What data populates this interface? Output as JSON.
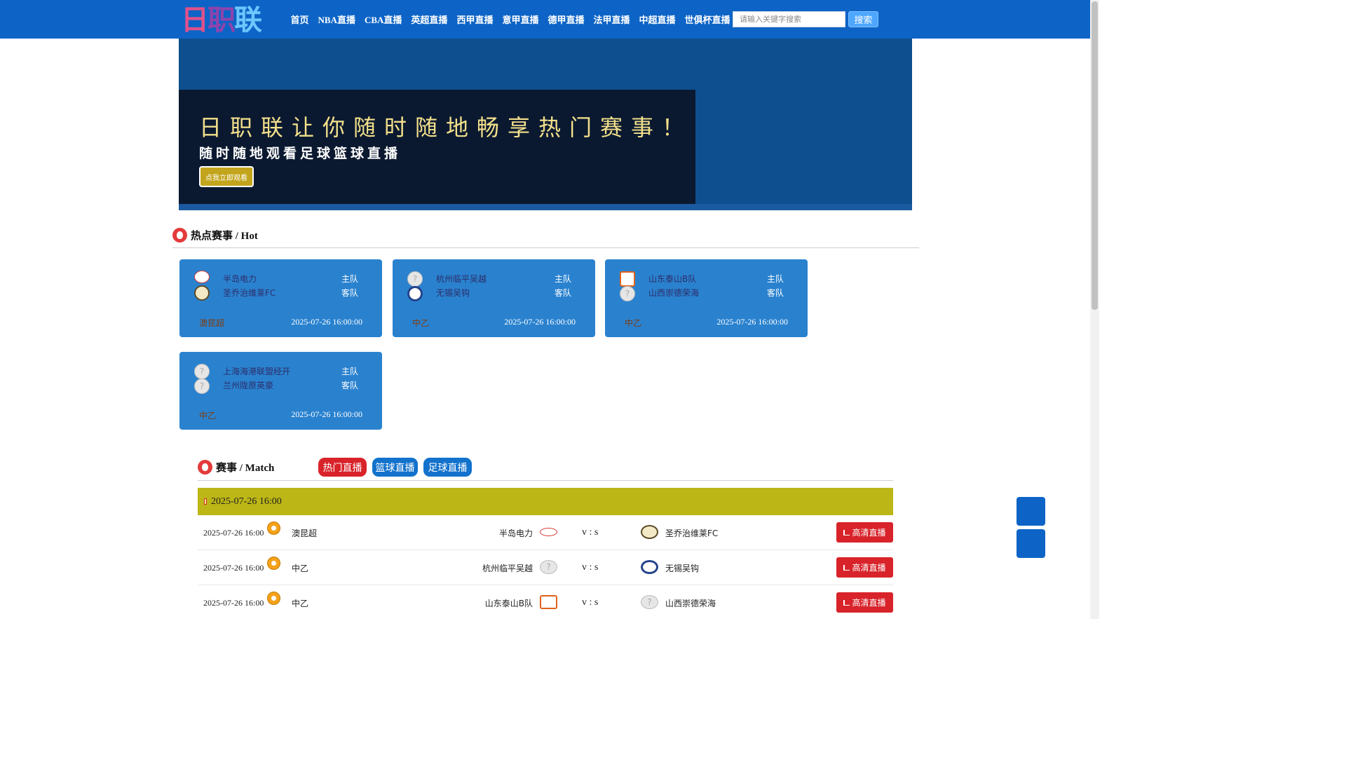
{
  "header": {
    "logo_text": [
      "日",
      "职",
      "联"
    ],
    "nav": [
      "首页",
      "NBA直播",
      "CBA直播",
      "英超直播",
      "西甲直播",
      "意甲直播",
      "德甲直播",
      "法甲直播",
      "中超直播",
      "世俱杯直播"
    ],
    "search_placeholder": "请输入关键字搜索",
    "search_button": "搜索"
  },
  "banner": {
    "headline": "日职联让你随时随地畅享热门赛事！",
    "subline": "随时随地观看足球篮球直播",
    "cta": "点我立即观看"
  },
  "hot": {
    "title": "热点赛事 / Hot",
    "cards": [
      {
        "home": "半岛电力",
        "away": "圣乔治维莱FC",
        "home_role": "主队",
        "away_role": "客队",
        "league": "澳昆超",
        "time": "2025-07-26 16:00:00",
        "home_icon": "red-crest-icon",
        "away_icon": "gold-crest-icon"
      },
      {
        "home": "杭州临平吴越",
        "away": "无锡吴钩",
        "home_role": "主队",
        "away_role": "客队",
        "league": "中乙",
        "time": "2025-07-26 16:00:00",
        "home_icon": "unknown-team-icon",
        "away_icon": "blue-crest-icon"
      },
      {
        "home": "山东泰山B队",
        "away": "山西崇德荣海",
        "home_role": "主队",
        "away_role": "客队",
        "league": "中乙",
        "time": "2025-07-26 16:00:00",
        "home_icon": "orange-shield-icon",
        "away_icon": "unknown-team-icon"
      },
      {
        "home": "上海海港联盟经开",
        "away": "兰州陇原英豪",
        "home_role": "主队",
        "away_role": "客队",
        "league": "中乙",
        "time": "2025-07-26 16:00:00",
        "home_icon": "unknown-team-icon",
        "away_icon": "unknown-team-icon"
      }
    ]
  },
  "matches": {
    "title": "赛事 / Match",
    "tabs": [
      "热门直播",
      "篮球直播",
      "足球直播"
    ],
    "date_header": "2025-07-26 16:00",
    "rows": [
      {
        "time": "2025-07-26 16:00",
        "league": "澳昆超",
        "home": "半岛电力",
        "vs": "v : s",
        "away": "圣乔治维莱FC",
        "action": "高清直播"
      },
      {
        "time": "2025-07-26 16:00",
        "league": "中乙",
        "home": "杭州临平吴越",
        "vs": "v : s",
        "away": "无锡吴钩",
        "action": "高清直播"
      },
      {
        "time": "2025-07-26 16:00",
        "league": "中乙",
        "home": "山东泰山B队",
        "vs": "v : s",
        "away": "山西崇德荣海",
        "action": "高清直播"
      }
    ]
  },
  "colors": {
    "nav_bg": "#0d64c6",
    "card_bg": "#2a82cf",
    "date_bar": "#bcb616",
    "live_btn": "#d8232a",
    "tab_hot": "#d8232a",
    "tab_other": "#1272cc"
  }
}
